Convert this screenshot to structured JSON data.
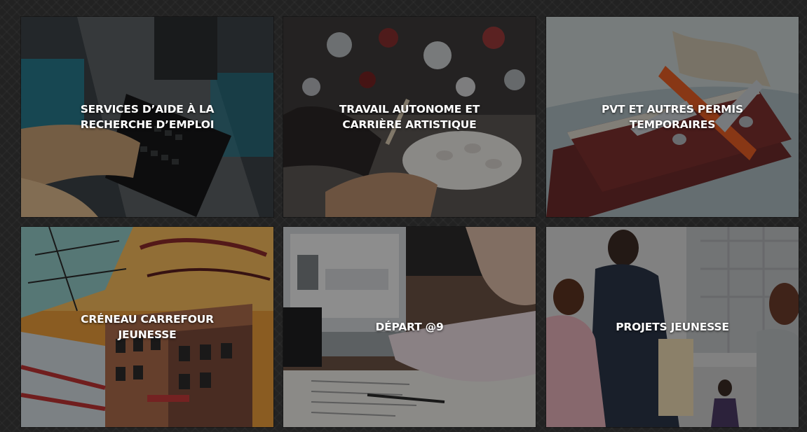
{
  "tiles": [
    {
      "label": "SERVICES D’AIDE À LA RECHERCHE D’EMPLOI",
      "image": "keyboard-desk-photo"
    },
    {
      "label": "TRAVAIL AUTONOME ET CARRIÈRE ARTISTIQUE",
      "image": "painter-palette-photo"
    },
    {
      "label": "PVT ET AUTRES PERMIS TEMPORAIRES",
      "image": "passports-airplane-photo"
    },
    {
      "label": "CRÉNEAU CARREFOUR JEUNESSE",
      "image": "graffiti-mural-photo"
    },
    {
      "label": "DÉPART @9",
      "image": "laptop-desk-photo"
    },
    {
      "label": "PROJETS JEUNESSE",
      "image": "young-people-walking-photo"
    }
  ]
}
